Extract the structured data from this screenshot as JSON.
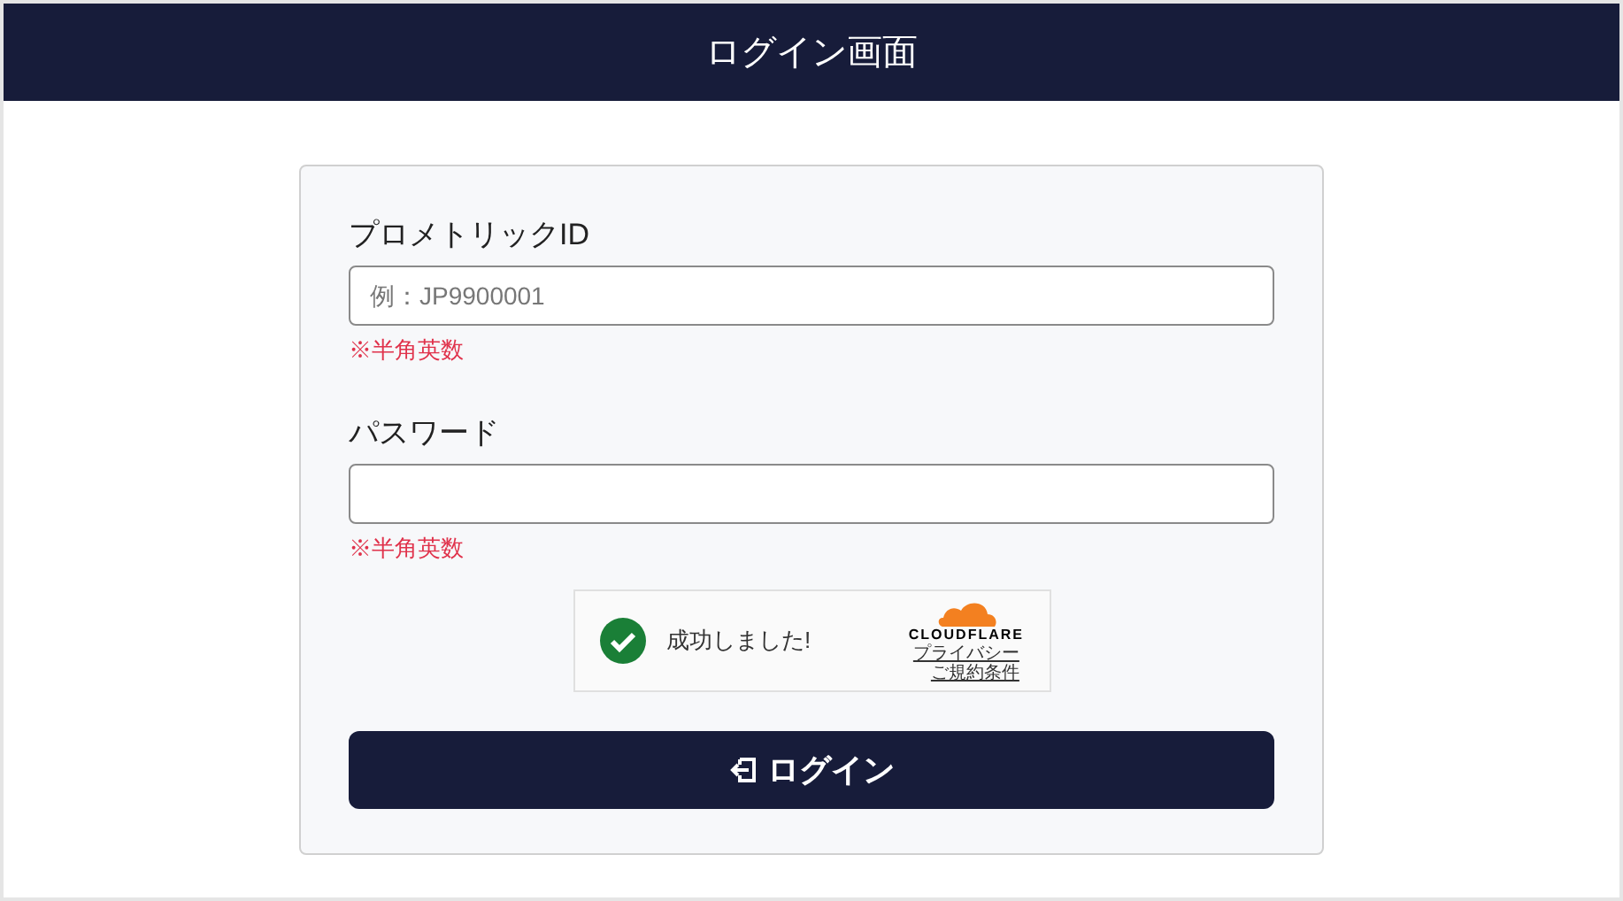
{
  "header": {
    "title": "ログイン画面"
  },
  "fields": [
    {
      "label": "プロメトリックID",
      "placeholder": "例：JP9900001",
      "note": "※半角英数"
    },
    {
      "label": "パスワード",
      "note": "※半角英数"
    }
  ],
  "captcha": {
    "status": "成功しました!",
    "success": true,
    "brand": "CLOUDFLARE",
    "links": [
      "プライバシー",
      "ご規約条件"
    ]
  },
  "login_button": {
    "label": "ログイン"
  }
}
